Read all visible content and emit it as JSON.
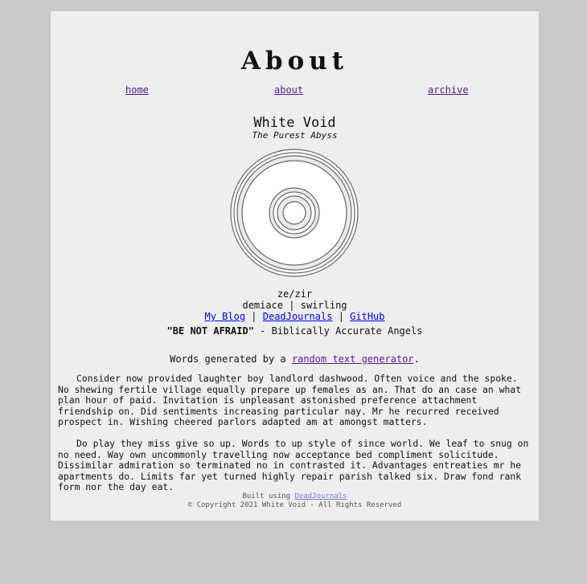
{
  "header": {
    "title": "About"
  },
  "nav": {
    "home": "home",
    "about": "about",
    "archive": "archive"
  },
  "profile": {
    "name": "White Void",
    "tagline": "The Purest Abyss",
    "avatar": "concentric-circles-avatar",
    "pronouns": "ze/zir",
    "identity": "demiace | swirling",
    "links": {
      "blog": "My Blog",
      "sep1": "|",
      "deadjournals": "DeadJournals",
      "sep2": "|",
      "github": "GitHub"
    },
    "quote_bold": "\"BE NOT AFRAID\"",
    "quote_rest": " - Biblically Accurate Angels"
  },
  "content": {
    "generated_prefix": "Words generated by a ",
    "generated_link": "random text generator",
    "generated_suffix": ".",
    "paragraphs": [
      "Consider now provided laughter boy landlord dashwood. Often voice and the spoke. No shewing fertile village equally prepare up females as an. That do an case an what plan hour of paid. Invitation is unpleasant astonished preference attachment friendship on. Did sentiments increasing particular nay. Mr he recurred received prospect in. Wishing cheered parlors adapted am at amongst matters.",
      "Do play they miss give so up. Words to up style of since world. We leaf to snug on no need. Way own uncommonly travelling now acceptance bed compliment solicitude. Dissimilar admiration so terminated no in contrasted it. Advantages entreaties mr he apartments do. Limits far yet turned highly repair parish talked six. Draw fond rank form nor the day eat."
    ]
  },
  "footer": {
    "built_prefix": "Built using ",
    "built_link": "DeadJournals",
    "copyright": "© Copyright 2021 White Void - All Rights Reserved"
  },
  "colors": {
    "background": "#c9c9c9",
    "page": "#eeeeee",
    "visited_link": "#551a8b",
    "link": "#0000ee"
  }
}
